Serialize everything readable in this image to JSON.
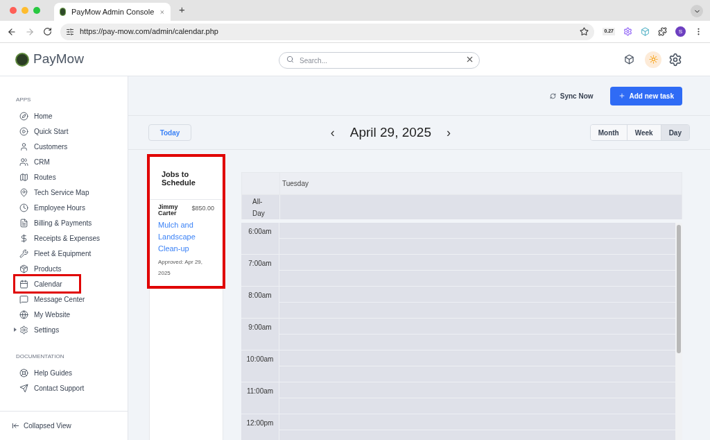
{
  "browser": {
    "tab_title": "PayMow Admin Console",
    "new_tab": "+",
    "url": "https://pay-mow.com/admin/calendar.php",
    "extension_badge": "0.27",
    "profile_initial": "S"
  },
  "header": {
    "brand": "PayMow",
    "search": {
      "placeholder": "Search..."
    }
  },
  "sidebar": {
    "sections": [
      {
        "title": "APPS",
        "items": [
          {
            "label": "Home",
            "highlighted": false,
            "expandable": false
          },
          {
            "label": "Quick Start",
            "highlighted": false,
            "expandable": false
          },
          {
            "label": "Customers",
            "highlighted": false,
            "expandable": false
          },
          {
            "label": "CRM",
            "highlighted": false,
            "expandable": false
          },
          {
            "label": "Routes",
            "highlighted": false,
            "expandable": false
          },
          {
            "label": "Tech Service Map",
            "highlighted": false,
            "expandable": false
          },
          {
            "label": "Employee Hours",
            "highlighted": false,
            "expandable": false
          },
          {
            "label": "Billing & Payments",
            "highlighted": false,
            "expandable": false
          },
          {
            "label": "Receipts & Expenses",
            "highlighted": false,
            "expandable": false
          },
          {
            "label": "Fleet & Equipment",
            "highlighted": false,
            "expandable": false
          },
          {
            "label": "Products",
            "highlighted": false,
            "expandable": false
          },
          {
            "label": "Calendar",
            "highlighted": true,
            "expandable": false
          },
          {
            "label": "Message Center",
            "highlighted": false,
            "expandable": false
          },
          {
            "label": "My Website",
            "highlighted": false,
            "expandable": false
          },
          {
            "label": "Settings",
            "highlighted": false,
            "expandable": true
          }
        ]
      },
      {
        "title": "DOCUMENTATION",
        "items": [
          {
            "label": "Help Guides",
            "highlighted": false,
            "expandable": false
          },
          {
            "label": "Contact Support",
            "highlighted": false,
            "expandable": false
          }
        ]
      }
    ],
    "footer": "Collapsed View"
  },
  "actions": {
    "sync": "Sync Now",
    "add": "Add new task"
  },
  "toolbar": {
    "today": "Today",
    "prev": "‹",
    "date": "April 29, 2025",
    "next": "›",
    "views": [
      {
        "label": "Month",
        "selected": false
      },
      {
        "label": "Week",
        "selected": false
      },
      {
        "label": "Day",
        "selected": true
      }
    ]
  },
  "jobs": {
    "title": "Jobs to Schedule",
    "highlighted": true,
    "items": [
      {
        "customer": "Jimmy Carter",
        "amount": "$850.00",
        "job": "Mulch and Landscape Clean-up",
        "approved": "Approved: Apr 29, 2025"
      }
    ]
  },
  "day": {
    "column": "Tuesday",
    "all_day": "All-Day",
    "slots": [
      "6:00am",
      "7:00am",
      "8:00am",
      "9:00am",
      "10:00am",
      "11:00am",
      "12:00pm"
    ]
  }
}
